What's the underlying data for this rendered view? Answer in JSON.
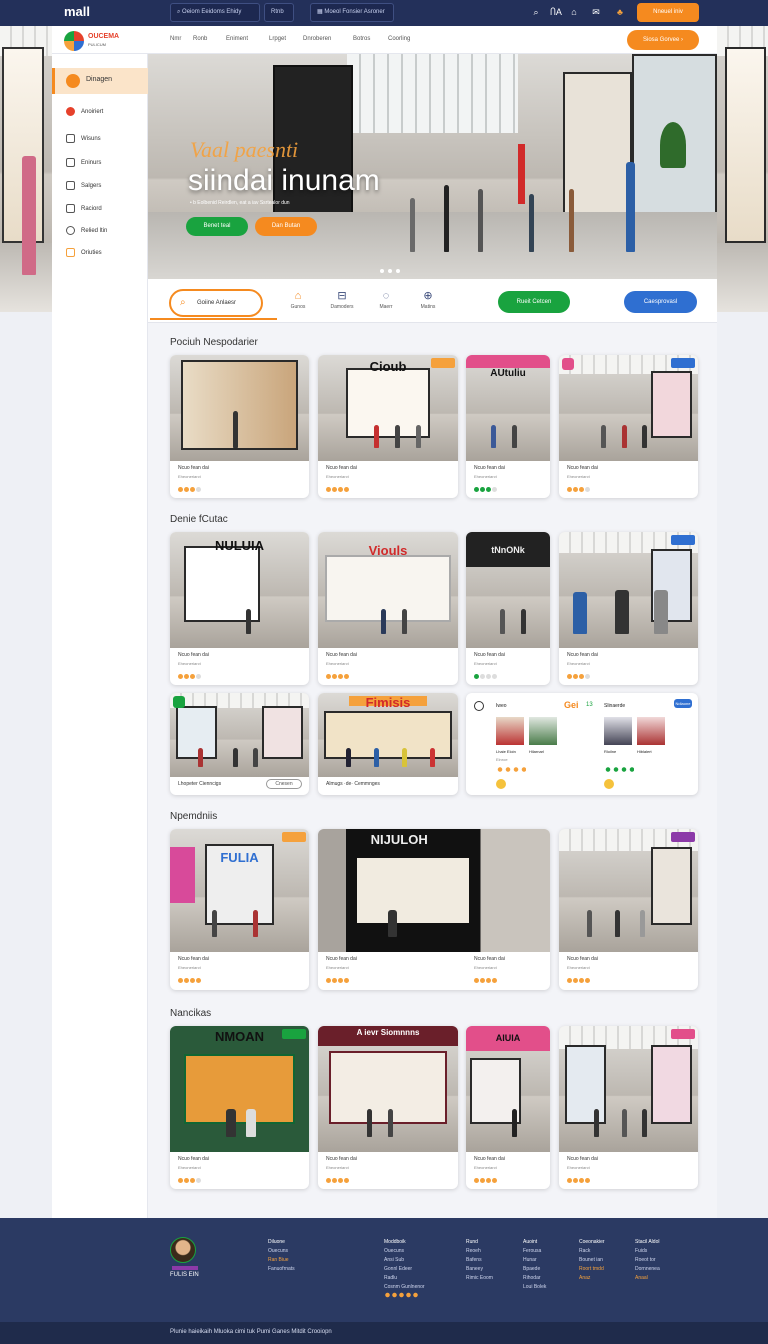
{
  "app": {
    "logo": "mall",
    "brand_name": "OUCEMA",
    "brand_sub": "PULICUM"
  },
  "topbar": {
    "search_value": "Oeiom Eeidoms Ehidy",
    "location": "Rtnb",
    "secondary_search": "Moeol Fonsier Asroner",
    "cta_label": "Nneuel iniv"
  },
  "nav": {
    "items": [
      "Nmr",
      "Ronb",
      "Eniment",
      "Lrpget",
      "Dnroberen",
      "Botros",
      "Coorling"
    ],
    "cta_label": "Siosa Gorvee"
  },
  "sidebar": {
    "active_label": "Dinagen",
    "items": [
      "Anoiriert",
      "Wisuns",
      "Eninurs",
      "Salgers",
      "Raciord",
      "Relied ltin",
      "Oriuties"
    ]
  },
  "hero": {
    "title_script": "Vaal paesnti",
    "title_main": "siindai inunam",
    "subtitle": "• b Eolbenid Reirdlen, eat a iav Ssrtealor dun",
    "btn_primary": "Benet teal",
    "btn_secondary": "Dan Butan"
  },
  "strip": {
    "search_label": "Goiine Anlaesr",
    "icons": [
      {
        "label": "Gunos",
        "icon": "home-icon"
      },
      {
        "label": "Damoders",
        "icon": "bag-icon"
      },
      {
        "label": "Maerr",
        "icon": "chat-icon"
      },
      {
        "label": "Matins",
        "icon": "globe-icon"
      }
    ],
    "btn_green": "Rueit Cetcen",
    "btn_blue": "Caesprovasl"
  },
  "sections": {
    "s1": "Pociuh Nespodarier",
    "s2": "Denie fCutac",
    "s3": "Npemdniis",
    "s4": "Nancikas"
  },
  "card_text": {
    "line1": "Ncuo fean dai",
    "line2": "Eheoneriarct"
  },
  "card_signs": [
    "Cioub",
    "AUtuliu",
    "NULUIA",
    "Viouls",
    "tNnONk",
    "Fimisis",
    "FULIA",
    "NIJULOH",
    "NMOAN",
    "A ievr Siomnnns",
    "AIUIA"
  ],
  "wide_cards": {
    "a_label": "Lhopeter Cienncigs",
    "a_btn": "Cnesen",
    "b_label": "Almugs ·de· Cemmnges",
    "promo_title": "Gei",
    "promo_num": "13",
    "promo_tag": "Ndiaone",
    "promo_cols": [
      "Iweo",
      "Slinaerde",
      "Rtuerd"
    ],
    "promo_items": [
      "Lhaie Eloin",
      "Hilarnarl",
      "Elnroe",
      "Rloilne",
      "Hiblalert"
    ]
  },
  "footer": {
    "profile_name": "FULIS EIN",
    "cols": [
      {
        "head": "Diluone",
        "lines": [
          "Ouecuns",
          "Ran Biue",
          "Fanuofrnats"
        ]
      },
      {
        "head": "Moddboik",
        "lines": [
          "Ouecuns",
          "Ansi Sub",
          "Gonnl Edeer",
          "Radlu",
          "Cosnm Gunlnenor"
        ]
      },
      {
        "head": "Rund",
        "lines": [
          "Reoeh",
          "Bafens",
          "Baneey",
          "Rimic Eoom"
        ]
      },
      {
        "head": "Auoint",
        "lines": [
          "Ferousa",
          "Hunar",
          "Bpaede",
          "Rihodar",
          "Loui Bolek"
        ]
      },
      {
        "head": "Coeonakier",
        "lines": [
          "Rack",
          "Bounet ian",
          "Roort tmdd",
          "Anaz"
        ]
      },
      {
        "head": "Stacil Aldol",
        "lines": [
          "Fuids",
          "Roeot tor",
          "Dornnenea",
          "Anaal"
        ]
      }
    ],
    "copyright": "Plunie haieikaih Mluoka cimi tuk Pumi Ganes Mitdit Crooiopn"
  },
  "colors": {
    "orange": "#f58a1f",
    "green": "#19a33f",
    "blue": "#2f6fd1",
    "navy": "#23305a"
  }
}
